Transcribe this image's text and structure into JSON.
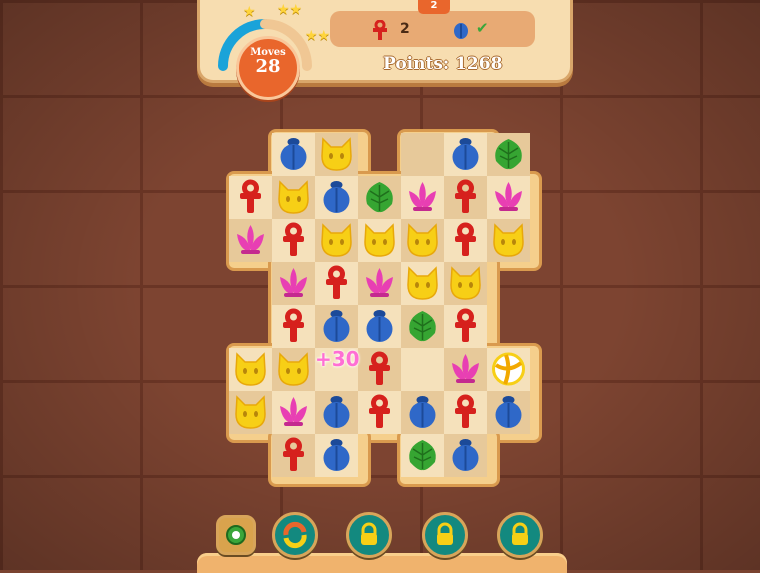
{
  "hud": {
    "moves_label": "Moves",
    "moves_value": "28",
    "level": "2",
    "goal_1_count": "2",
    "goal_2_status": "✔",
    "points": "Points: 1268",
    "progress_fraction": 0.35
  },
  "board": {
    "popup": "+30",
    "rows": [
      [
        null,
        null,
        "scarab",
        "cat",
        null,
        null,
        "scarab",
        "leaf",
        null,
        null
      ],
      [
        null,
        "ankh",
        "cat",
        "scarab",
        "leaf",
        "lotus",
        "ankh",
        "lotus",
        null,
        null
      ],
      [
        null,
        "lotus",
        "ankh",
        "cat",
        "cat",
        "cat",
        "ankh",
        "cat",
        null,
        null
      ],
      [
        null,
        null,
        "lotus",
        "ankh",
        "lotus",
        "cat",
        "cat",
        null,
        null,
        null
      ],
      [
        null,
        null,
        "ankh",
        "scarab",
        "scarab",
        "leaf",
        "ankh",
        null,
        null,
        null
      ],
      [
        null,
        "cat",
        "cat",
        null,
        "ankh",
        null,
        "lotus",
        "ball",
        null,
        null
      ],
      [
        null,
        "cat",
        "lotus",
        "scarab",
        "ankh",
        "scarab",
        "ankh",
        "scarab",
        null,
        null
      ],
      [
        null,
        null,
        "ankh",
        "scarab",
        null,
        "leaf",
        "scarab",
        null,
        null,
        null
      ]
    ]
  },
  "colors": {
    "ankh": "#d6211d",
    "cat": "#f7cf16",
    "scarab": "#2f68c8",
    "leaf": "#36a532",
    "lotus": "#e83fb3",
    "accent": "#e9662c"
  },
  "toolbar": {
    "buttons": [
      "settings-icon",
      "shuffle-icon",
      "lock-icon",
      "lock-icon",
      "lock-icon"
    ]
  }
}
